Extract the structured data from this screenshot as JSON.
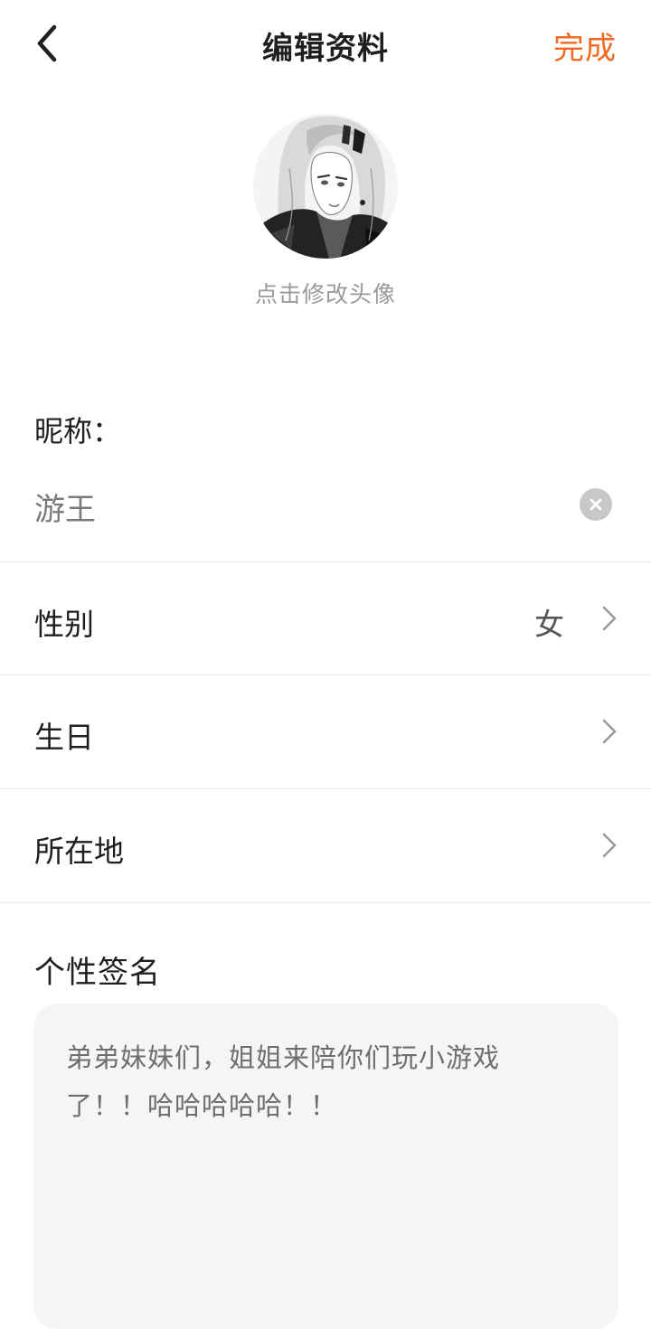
{
  "header": {
    "back_icon": "chevron-left-icon",
    "title": "编辑资料",
    "done_label": "完成",
    "accent_color": "#f26a21"
  },
  "avatar": {
    "hint": "点击修改头像"
  },
  "nickname": {
    "label": "昵称：",
    "value": "游王",
    "clear_icon": "clear-icon"
  },
  "rows": [
    {
      "label": "性别",
      "value": "女",
      "icon": "chevron-right-icon"
    },
    {
      "label": "生日",
      "value": "",
      "icon": "chevron-right-icon"
    },
    {
      "label": "所在地",
      "value": "",
      "icon": "chevron-right-icon"
    }
  ],
  "signature": {
    "title": "个性签名",
    "text": "弟弟妹妹们，姐姐来陪你们玩小游戏了！！哈哈哈哈哈！！"
  }
}
